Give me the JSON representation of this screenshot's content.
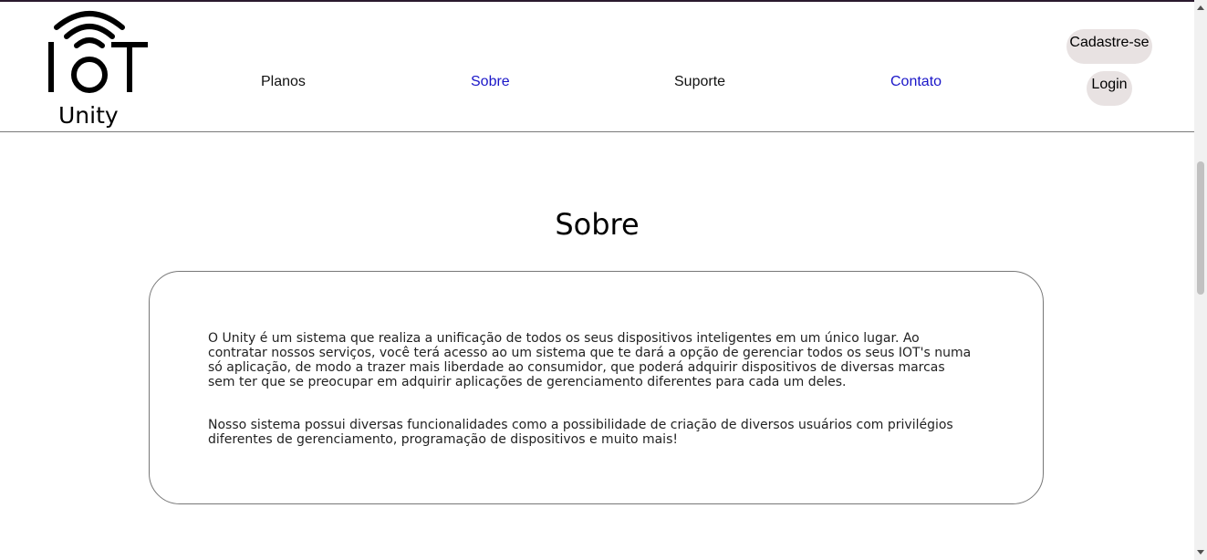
{
  "brand": {
    "logo_text": "IOT",
    "word": "Unity"
  },
  "nav": [
    {
      "label": "Planos",
      "color": "#111111"
    },
    {
      "label": "Sobre",
      "color": "#1a16c8"
    },
    {
      "label": "Suporte",
      "color": "#111111"
    },
    {
      "label": "Contato",
      "color": "#1a16c8"
    }
  ],
  "actions": {
    "signup_label": "Cadastre-se",
    "login_label": "Login"
  },
  "main": {
    "title": "Sobre",
    "paragraphs": [
      "O Unity é um sistema que realiza a unificação de todos os seus dispositivos inteligentes em um único lugar. Ao contratar nossos serviços, você terá acesso ao um sistema que te dará a opção de gerenciar todos os seus IOT's numa só aplicação, de modo a trazer mais liberdade ao consumidor, que poderá adquirir dispositivos de diversas marcas sem ter que se preocupar em adquirir aplicações de gerenciamento diferentes para cada um deles.",
      "Nosso sistema possui diversas funcionalidades como a possibilidade de criação de diversos usuários com privilégios diferentes de gerenciamento, programação de dispositivos e muito mais!"
    ]
  }
}
